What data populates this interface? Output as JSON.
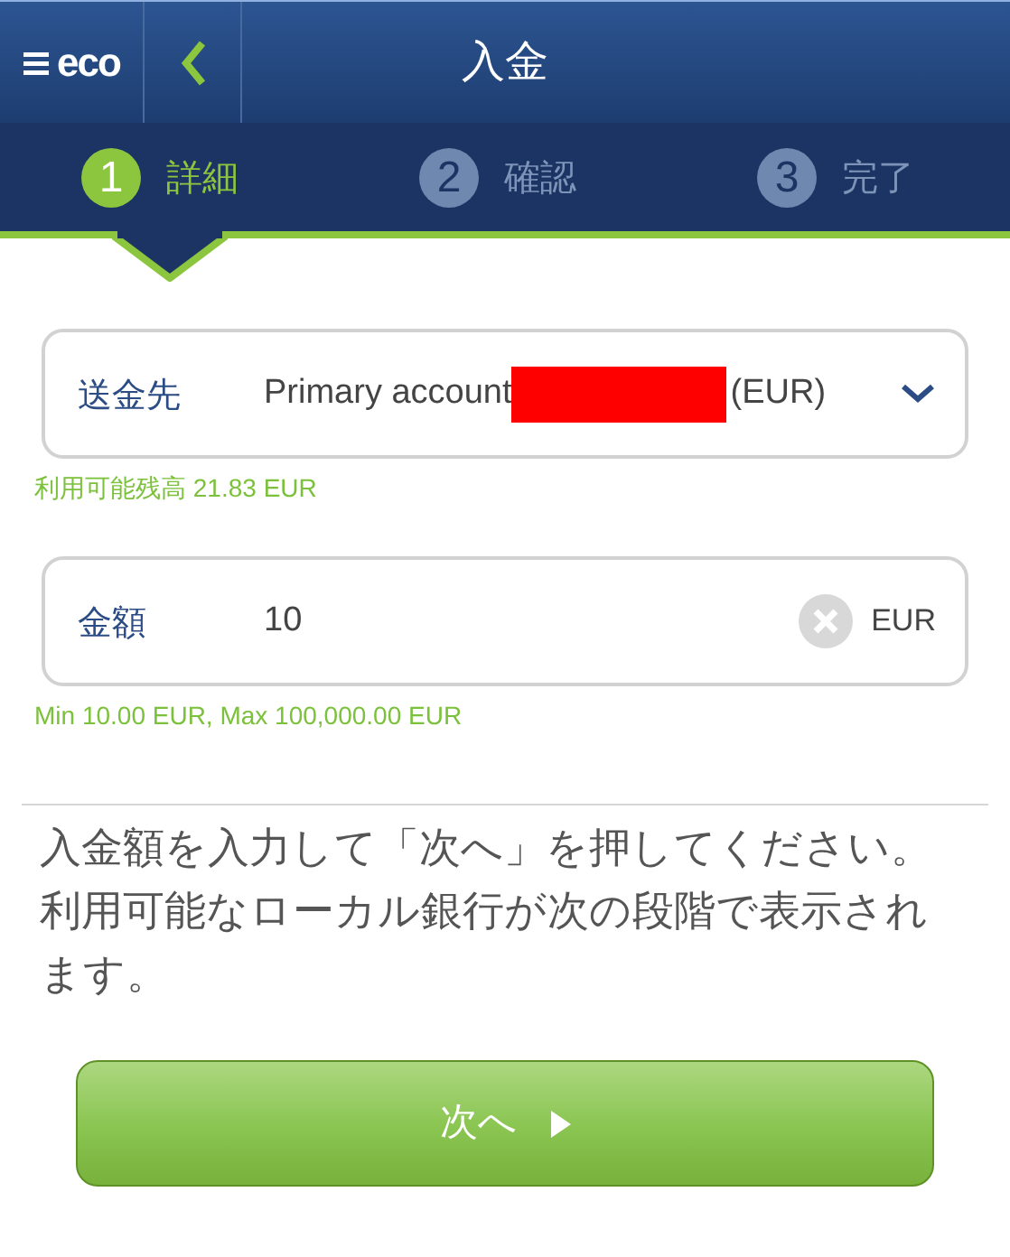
{
  "header": {
    "logo": "eco",
    "title": "入金"
  },
  "steps": [
    {
      "number": "1",
      "label": "詳細",
      "selected": true
    },
    {
      "number": "2",
      "label": "確認",
      "selected": false
    },
    {
      "number": "3",
      "label": "完了",
      "selected": false
    }
  ],
  "fields": [
    {
      "kind": "dropdown",
      "label": "送金先",
      "value": "Primary account",
      "redacted": true,
      "suffix": "(EUR)",
      "hint": "利用可能残高 21.83 EUR"
    },
    {
      "kind": "input",
      "label": "金額",
      "value": "10",
      "suffix": "EUR",
      "hint": "Min 10.00 EUR, Max 100,000.00 EUR"
    }
  ],
  "instructions": "入金額を入力して「次へ」を押してください。利用可能なローカル銀行が次の段階で表示されます。",
  "next_button": "次へ"
}
